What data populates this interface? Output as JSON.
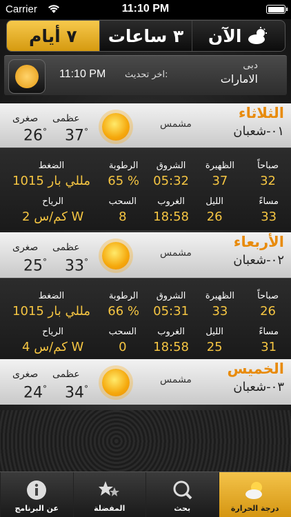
{
  "status": {
    "carrier": "Carrier",
    "time": "11:10 PM"
  },
  "tabs": [
    {
      "label": "الآن"
    },
    {
      "label": "٣ ساعات"
    },
    {
      "label": "٧ أيام"
    }
  ],
  "update": {
    "label": "اخر تحديث:",
    "time": "11:10 PM",
    "city": "دبى",
    "country": "الامارات"
  },
  "labels": {
    "max": "عظمى",
    "min": "صغرى",
    "morning": "صباحاً",
    "evening": "مساءً",
    "noon": "الظهيرة",
    "night": "الليل",
    "sunrise": "الشروق",
    "sunset": "الغروب",
    "humidity": "الرطوبة",
    "clouds": "السحب",
    "pressure": "الضغط",
    "wind": "الرياح"
  },
  "days": [
    {
      "name": "الثلاثاء",
      "hijri": "٠١-شعبان",
      "cond": "مشمس",
      "max": "37",
      "min": "26",
      "morning": "32",
      "noon": "37",
      "evening": "33",
      "night": "26",
      "sunrise": "05:32",
      "sunset": "18:58",
      "humidity": "65 %",
      "clouds": "8",
      "pressure": "1015 مللي بار",
      "wind": "2 كم/س W"
    },
    {
      "name": "الأربعاء",
      "hijri": "٠٢-شعبان",
      "cond": "مشمس",
      "max": "33",
      "min": "25",
      "morning": "26",
      "noon": "33",
      "evening": "31",
      "night": "25",
      "sunrise": "05:31",
      "sunset": "18:58",
      "humidity": "66 %",
      "clouds": "0",
      "pressure": "1015 مللي بار",
      "wind": "4 كم/س W"
    },
    {
      "name": "الخميس",
      "hijri": "٠٣-شعبان",
      "cond": "مشمس",
      "max": "34",
      "min": "24"
    }
  ],
  "tabbar": [
    {
      "label": "عن البرنامج",
      "icon": "info-icon"
    },
    {
      "label": "المفضلة",
      "icon": "stars-icon"
    },
    {
      "label": "بحث",
      "icon": "search-icon"
    },
    {
      "label": "درجة الحرارة",
      "icon": "weather-icon"
    }
  ]
}
